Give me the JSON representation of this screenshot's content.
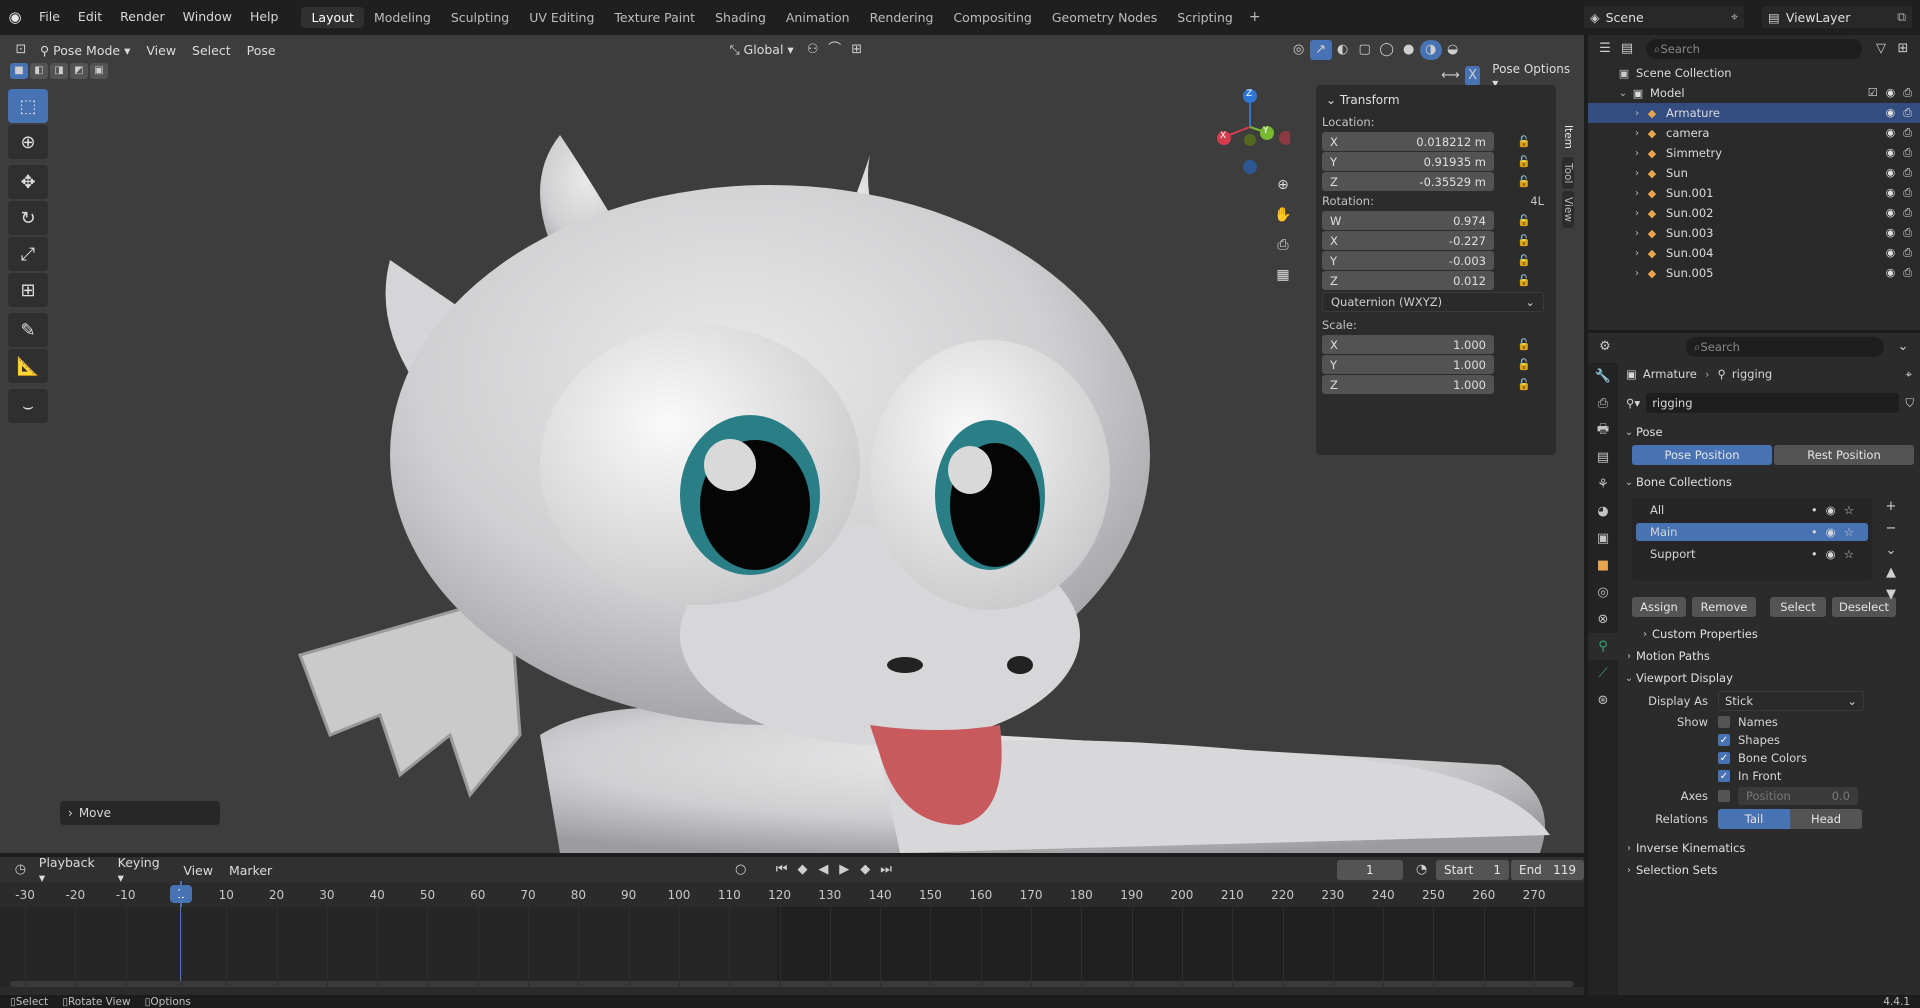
{
  "topbar": {
    "menus": [
      "File",
      "Edit",
      "Render",
      "Window",
      "Help"
    ],
    "workspaces": [
      "Layout",
      "Modeling",
      "Sculpting",
      "UV Editing",
      "Texture Paint",
      "Shading",
      "Animation",
      "Rendering",
      "Compositing",
      "Geometry Nodes",
      "Scripting"
    ],
    "active_workspace": "Layout",
    "scene": "Scene",
    "view_layer": "ViewLayer"
  },
  "viewport": {
    "mode": "Pose Mode",
    "menus": [
      "View",
      "Select",
      "Pose"
    ],
    "orientation": "Global",
    "pose_options": "Pose Options",
    "last_op": "Move",
    "gizmo_axes": [
      "X",
      "Y",
      "Z"
    ]
  },
  "npanel": {
    "tabs": [
      "Item",
      "Tool",
      "View"
    ],
    "title": "Transform",
    "location_label": "Location:",
    "location": [
      {
        "axis": "X",
        "value": "0.018212 m"
      },
      {
        "axis": "Y",
        "value": "0.91935 m"
      },
      {
        "axis": "Z",
        "value": "-0.35529 m"
      }
    ],
    "rotation_label": "Rotation:",
    "rotation_mode_tag": "4L",
    "rotation": [
      {
        "axis": "W",
        "value": "0.974"
      },
      {
        "axis": "X",
        "value": "-0.227"
      },
      {
        "axis": "Y",
        "value": "-0.003"
      },
      {
        "axis": "Z",
        "value": "0.012"
      }
    ],
    "rotation_mode": "Quaternion (WXYZ)",
    "scale_label": "Scale:",
    "scale": [
      {
        "axis": "X",
        "value": "1.000"
      },
      {
        "axis": "Y",
        "value": "1.000"
      },
      {
        "axis": "Z",
        "value": "1.000"
      }
    ]
  },
  "timeline": {
    "menus": [
      "Playback",
      "Keying",
      "View",
      "Marker"
    ],
    "current_frame": "1",
    "start_label": "Start",
    "start": "1",
    "end_label": "End",
    "end": "119",
    "ticks": [
      "-30",
      "-20",
      "-10",
      "1",
      "10",
      "20",
      "30",
      "40",
      "50",
      "60",
      "70",
      "80",
      "90",
      "100",
      "110",
      "120",
      "130",
      "140",
      "150",
      "160",
      "170",
      "180",
      "190",
      "200",
      "210",
      "220",
      "230",
      "240",
      "250",
      "260",
      "270"
    ]
  },
  "outliner": {
    "search_placeholder": "Search",
    "scene_collection": "Scene Collection",
    "collection": "Model",
    "items": [
      {
        "name": "Armature",
        "selected": true
      },
      {
        "name": "camera",
        "selected": false
      },
      {
        "name": "Simmetry",
        "selected": false
      },
      {
        "name": "Sun",
        "selected": false
      },
      {
        "name": "Sun.001",
        "selected": false
      },
      {
        "name": "Sun.002",
        "selected": false
      },
      {
        "name": "Sun.003",
        "selected": false
      },
      {
        "name": "Sun.004",
        "selected": false
      },
      {
        "name": "Sun.005",
        "selected": false
      }
    ]
  },
  "properties": {
    "search_placeholder": "Search",
    "breadcrumb_object": "Armature",
    "breadcrumb_data": "rigging",
    "data_name": "rigging",
    "pose_section": "Pose",
    "pose_position": "Pose Position",
    "rest_position": "Rest Position",
    "bone_collections_section": "Bone Collections",
    "bone_collections": [
      "All",
      "Main",
      "Support"
    ],
    "active_collection": "Main",
    "assign": "Assign",
    "remove": "Remove",
    "select": "Select",
    "deselect": "Deselect",
    "custom_properties": "Custom Properties",
    "motion_paths": "Motion Paths",
    "viewport_display": "Viewport Display",
    "display_as_label": "Display As",
    "display_as": "Stick",
    "show_label": "Show",
    "show_options": [
      {
        "label": "Names",
        "checked": false
      },
      {
        "label": "Shapes",
        "checked": true
      },
      {
        "label": "Bone Colors",
        "checked": true
      },
      {
        "label": "In Front",
        "checked": true
      }
    ],
    "axes_label": "Axes",
    "axes_position_label": "Position",
    "axes_position_value": "0.0",
    "relations_label": "Relations",
    "tail": "Tail",
    "head": "Head",
    "inverse_kinematics": "Inverse Kinematics",
    "selection_sets": "Selection Sets"
  },
  "statusbar": {
    "select": "Select",
    "rotate_view": "Rotate View",
    "options": "Options",
    "version": "4.4.1"
  }
}
